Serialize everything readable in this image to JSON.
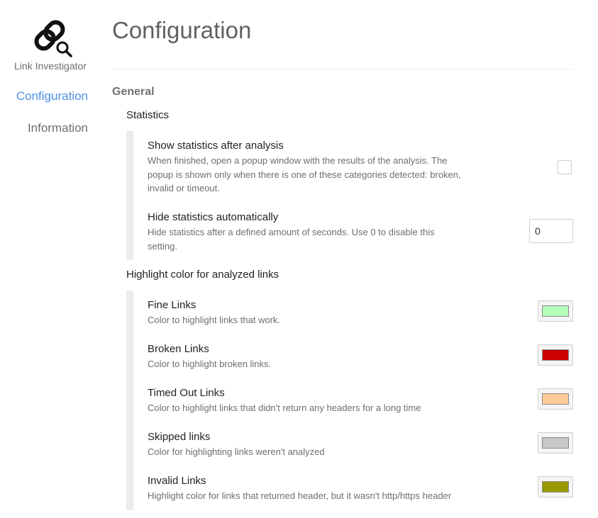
{
  "sidebar": {
    "logo_icon": "chain-link-magnifier-icon",
    "app_name": "Link Investigator",
    "items": [
      {
        "label": "Configuration",
        "active": true
      },
      {
        "label": "Information",
        "active": false
      }
    ]
  },
  "page": {
    "title": "Configuration"
  },
  "general": {
    "title": "General",
    "statistics": {
      "title": "Statistics",
      "show_after_analysis": {
        "title": "Show statistics after analysis",
        "description": "When finished, open a popup window with the results of the analysis. The popup is shown only when there is one of these categories detected: broken, invalid or timeout.",
        "checked": false
      },
      "hide_automatically": {
        "title": "Hide statistics automatically",
        "description": "Hide statistics after a defined amount of seconds. Use 0 to disable this setting.",
        "value": "0"
      }
    },
    "highlight": {
      "title": "Highlight color for analyzed links",
      "items": [
        {
          "title": "Fine Links",
          "description": "Color to highlight links that work.",
          "color": "#b3ffb9"
        },
        {
          "title": "Broken Links",
          "description": "Color to highlight broken links.",
          "color": "#cc0000"
        },
        {
          "title": "Timed Out Links",
          "description": "Color to highlight links that didn't return any headers for a long time",
          "color": "#ffcc99"
        },
        {
          "title": "Skipped links",
          "description": "Color for highlighting links weren't analyzed",
          "color": "#c8c8c8"
        },
        {
          "title": "Invalid Links",
          "description": "Highlight color for links that returned header, but it wasn't http/https header",
          "color": "#999900"
        }
      ]
    }
  }
}
